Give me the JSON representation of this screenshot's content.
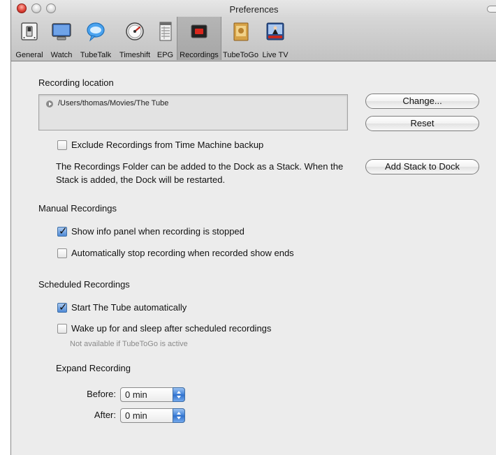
{
  "window": {
    "title": "Preferences"
  },
  "toolbar": {
    "items": [
      {
        "label": "General",
        "icon": "switch-icon"
      },
      {
        "label": "Watch",
        "icon": "monitor-icon"
      },
      {
        "label": "TubeTalk",
        "icon": "chat-bubble-icon"
      },
      {
        "label": "Timeshift",
        "icon": "gauge-icon"
      },
      {
        "label": "EPG",
        "icon": "epg-grid-icon"
      },
      {
        "label": "Recordings",
        "icon": "record-icon",
        "selected": true
      },
      {
        "label": "TubeToGo",
        "icon": "film-case-icon"
      },
      {
        "label": "Live TV",
        "icon": "live-tv-icon"
      }
    ]
  },
  "recording_location": {
    "title": "Recording location",
    "path": "/Users/thomas/Movies/The Tube",
    "change_label": "Change...",
    "reset_label": "Reset",
    "exclude_label": "Exclude Recordings from Time Machine backup",
    "exclude_checked": false,
    "stack_text": "The Recordings Folder can be added to the Dock as a Stack. When the Stack is added, the Dock will be restarted.",
    "add_stack_label": "Add Stack to Dock"
  },
  "manual": {
    "title": "Manual Recordings",
    "show_info_label": "Show info panel when recording is stopped",
    "show_info_checked": true,
    "auto_stop_label": "Automatically stop recording when recorded show ends",
    "auto_stop_checked": false
  },
  "scheduled": {
    "title": "Scheduled Recordings",
    "start_auto_label": "Start The Tube automatically",
    "start_auto_checked": true,
    "wake_label": "Wake up for and sleep after scheduled recordings",
    "wake_checked": false,
    "wake_note": "Not available if TubeToGo is active"
  },
  "expand": {
    "title": "Expand Recording",
    "before_label": "Before:",
    "before_value": "0 min",
    "after_label": "After:",
    "after_value": "0 min"
  },
  "colors": {
    "accent": "#4f8ad6",
    "window_bg": "#ececec"
  }
}
